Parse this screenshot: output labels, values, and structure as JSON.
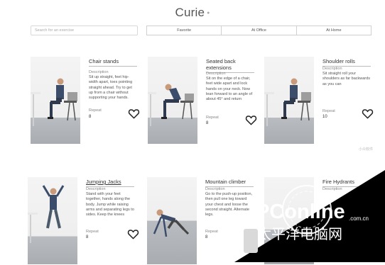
{
  "header": {
    "title": "Curie",
    "title_mark": "●"
  },
  "search": {
    "placeholder": "Search for an exercise"
  },
  "filters": [
    "Favorite",
    "At Office",
    "At Home"
  ],
  "exercises": [
    {
      "name": "Chair stands",
      "desc_label": "Description",
      "desc": "Sit up straight, feet hip-width apart, toes pointing straight ahead. Try to get up from a chair without supporting your hands.",
      "repeat_label": "Repeat",
      "repeat": "8"
    },
    {
      "name": "Seated back extensions",
      "desc_label": "Description",
      "desc": "Sit on the edge of a chair, feet wide apart and lock hands on your neck. Now lean forward to an angle of about 45° and return",
      "repeat_label": "Repeat",
      "repeat": "8"
    },
    {
      "name": "Shoulder rolls",
      "desc_label": "Description",
      "desc": "Sit straight roll your shoulders as far backwards as you can",
      "repeat_label": "Repeat",
      "repeat": "10"
    },
    {
      "name": "Jumping Jacks",
      "desc_label": "Description",
      "desc": "Stand with your feet together, hands along the body. Jump while raising arms and separating legs to sides. Keep the knees",
      "repeat_label": "Repeat",
      "repeat": "8"
    },
    {
      "name": "Mountain climber",
      "desc_label": "Description",
      "desc": "Go to the push-up position, then pull one leg toward your chest and loose the second straight. Alternate legs.",
      "repeat_label": "Repeat",
      "repeat": "8"
    },
    {
      "name": "Fire Hydrants",
      "desc_label": "Description",
      "desc": "",
      "repeat_label": "",
      "repeat": ""
    }
  ],
  "watermarks": {
    "small": "小众软件",
    "brand": "PConline",
    "domain": ".com.cn",
    "cn": "太平洋电脑网"
  }
}
